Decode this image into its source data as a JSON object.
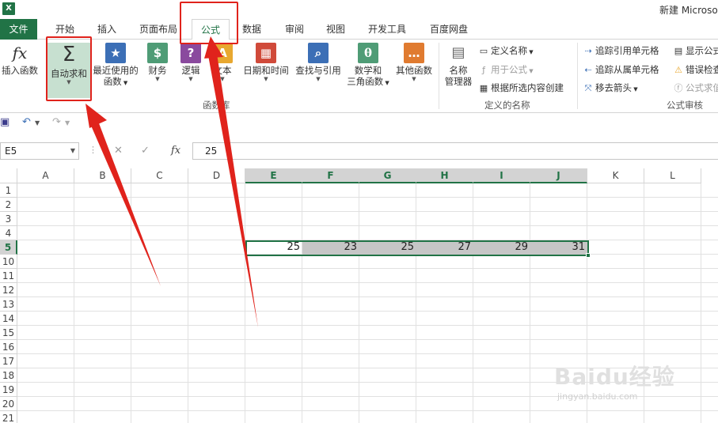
{
  "window": {
    "app_icon": "X",
    "title": "新建 Microso"
  },
  "tabs": [
    {
      "label": "文件"
    },
    {
      "label": "开始"
    },
    {
      "label": "插入"
    },
    {
      "label": "页面布局"
    },
    {
      "label": "公式"
    },
    {
      "label": "数据"
    },
    {
      "label": "审阅"
    },
    {
      "label": "视图"
    },
    {
      "label": "开发工具"
    },
    {
      "label": "百度网盘"
    }
  ],
  "active_tab": "公式",
  "ribbon": {
    "insert_function": {
      "label": "插入函数",
      "icon": "fx"
    },
    "autosum": {
      "label": "自动求和",
      "icon": "Σ"
    },
    "recent": {
      "label1": "最近使用的",
      "label2": "函数"
    },
    "financial": {
      "label": "财务"
    },
    "logical": {
      "label": "逻辑"
    },
    "text": {
      "label": "文本"
    },
    "datetime": {
      "label": "日期和时间"
    },
    "lookup": {
      "label": "查找与引用"
    },
    "math": {
      "label1": "数学和",
      "label2": "三角函数"
    },
    "more": {
      "label": "其他函数"
    },
    "library_group": "函数库",
    "name_manager": {
      "label1": "名称",
      "label2": "管理器"
    },
    "define_name": "定义名称",
    "use_in_formula": "用于公式",
    "create_from_selection": "根据所选内容创建",
    "names_group": "定义的名称",
    "trace_precedents": "追踪引用单元格",
    "trace_dependents": "追踪从属单元格",
    "remove_arrows": "移去箭头",
    "show_formulas": "显示公式",
    "error_checking": "错误检查",
    "evaluate_formula": "公式求值",
    "audit_group": "公式审核"
  },
  "namebox": "E5",
  "formula_value": "25",
  "columns": [
    "A",
    "B",
    "C",
    "D",
    "E",
    "F",
    "G",
    "H",
    "I",
    "J",
    "K",
    "L"
  ],
  "selected_columns": [
    "E",
    "F",
    "G",
    "H",
    "I",
    "J"
  ],
  "rows": [
    "1",
    "2",
    "3",
    "4",
    "5",
    "10",
    "11",
    "12",
    "13",
    "14",
    "15",
    "16",
    "17",
    "18",
    "19",
    "20",
    "21"
  ],
  "selected_row": "5",
  "row5_values": [
    "25",
    "23",
    "25",
    "27",
    "29",
    "31"
  ],
  "colors": {
    "accent": "#217346",
    "annotation": "#e0231c"
  },
  "watermark": {
    "brand": "Baidu经验",
    "url": "jingyan.baidu.com"
  }
}
